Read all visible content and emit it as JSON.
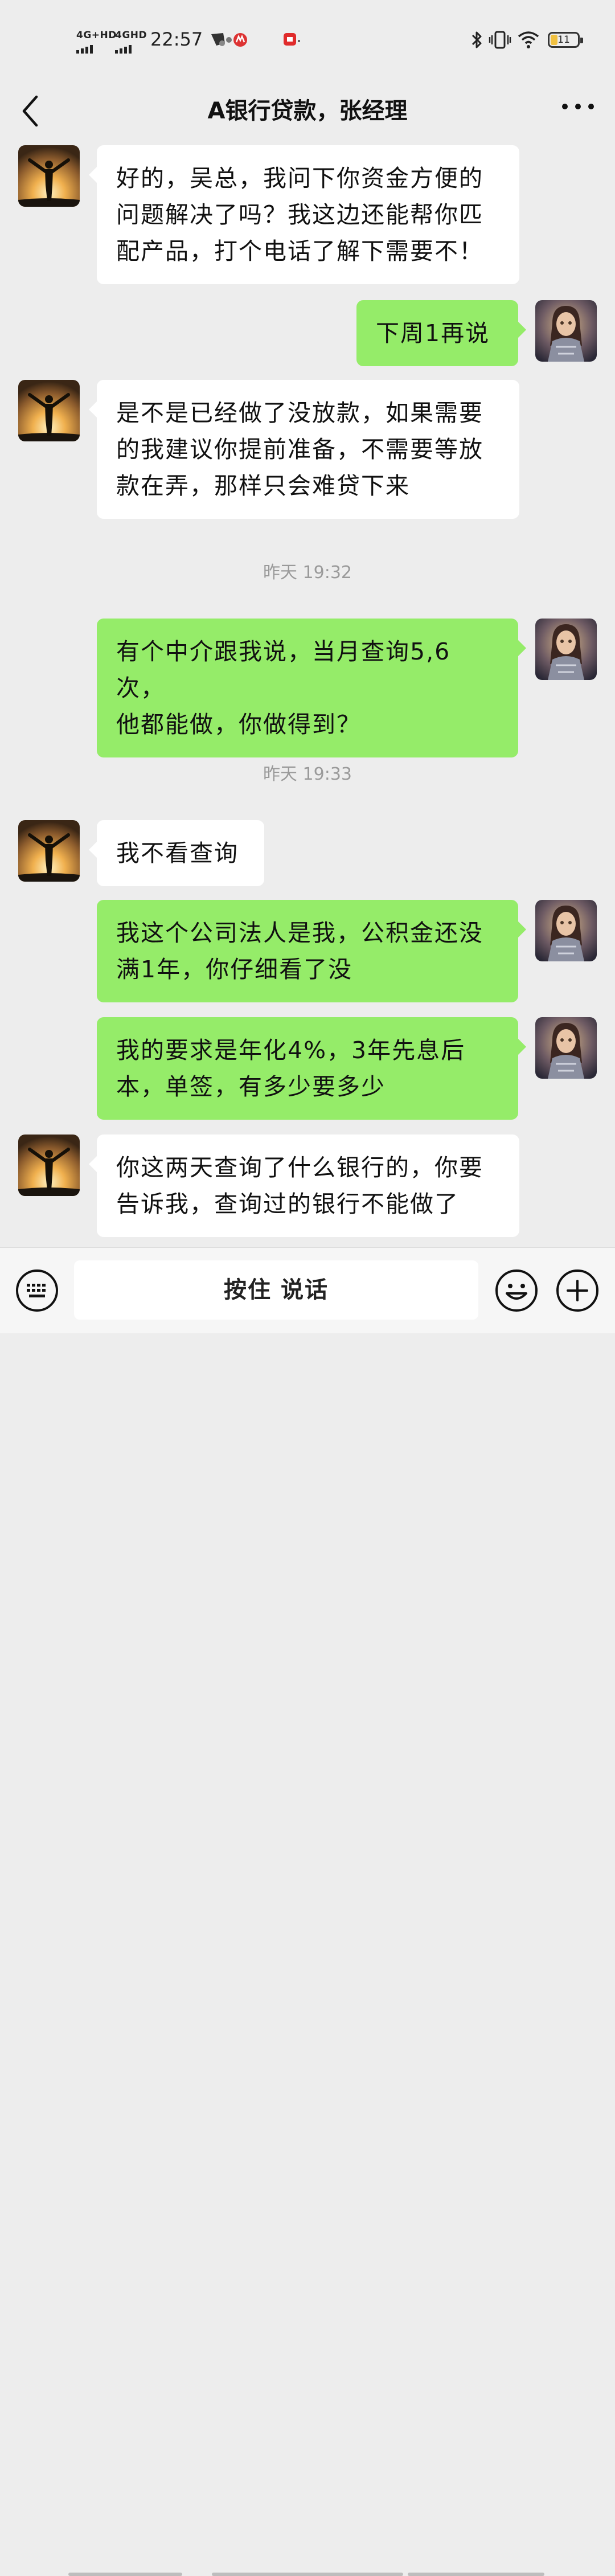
{
  "status_bar": {
    "network_1": "4G+HD",
    "network_2": "4GHD",
    "time": "22:57",
    "battery": "11",
    "icons": [
      "app-icon",
      "app-icon",
      "app-icon",
      "bluetooth-icon",
      "vibrate-icon",
      "wifi-icon",
      "battery-icon"
    ]
  },
  "nav": {
    "title": "A银行贷款，张经理",
    "back_icon": "chevron-left-icon",
    "more_icon": "more-icon"
  },
  "messages": [
    {
      "side": "in",
      "text": "好的，吴总，我问下你资金方便的\n问题解决了吗？我这边还能帮你匹\n配产品，打个电话了解下需要不！"
    },
    {
      "side": "out",
      "text": "下周1再说"
    },
    {
      "side": "in",
      "text": "是不是已经做了没放款，如果需要\n的我建议你提前准备，不需要等放\n款在弄，那样只会难贷下来"
    },
    {
      "side": "out",
      "text": "有个中介跟我说，当月查询5,6次，\n他都能做，你做得到？"
    },
    {
      "side": "in",
      "text": "我不看查询"
    },
    {
      "side": "out",
      "text": "我这个公司法人是我，公积金还没\n满1年，你仔细看了没"
    },
    {
      "side": "out",
      "text": "我的要求是年化4%，3年先息后\n本，单签，有多少要多少"
    },
    {
      "side": "in",
      "text": "你这两天查询了什么银行的，你要\n告诉我，查询过的银行不能做了"
    }
  ],
  "timestamps": [
    "昨天 19:32",
    "昨天 19:33"
  ],
  "input_bar": {
    "voice_label": "按住 说话",
    "left_icon": "keyboard-icon",
    "emoji_icon": "emoji-icon",
    "plus_icon": "plus-icon"
  },
  "colors": {
    "background": "#ededed",
    "incoming_bubble": "#ffffff",
    "outgoing_bubble": "#95ec69"
  }
}
